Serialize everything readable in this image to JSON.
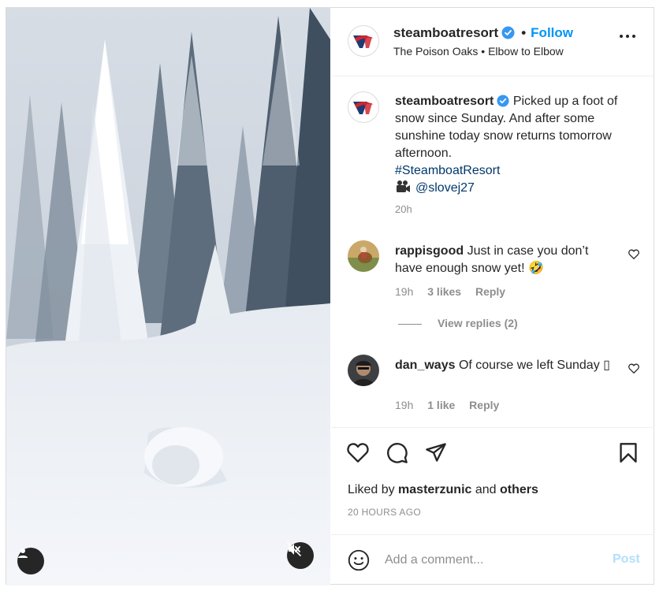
{
  "header": {
    "username": "steamboatresort",
    "verified": true,
    "separator": "•",
    "follow_label": "Follow",
    "location": "The Poison Oaks • Elbow to Elbow",
    "more_icon": "more-horizontal-icon"
  },
  "caption": {
    "username": "steamboatresort",
    "text": "Picked up a foot of snow since Sunday. And after some sunshine today snow returns tomorrow afternoon.",
    "hashtag": "#SteamboatResort",
    "camera_icon": "video-camera-icon",
    "mention": "@slovej27",
    "time": "20h"
  },
  "comments": [
    {
      "username": "rappisgood",
      "text": "Just in case you don’t have enough snow yet! 🤣",
      "time": "19h",
      "likes": "3 likes",
      "reply_label": "Reply"
    },
    {
      "username": "dan_ways",
      "text": "Of course we left Sunday ▯",
      "time": "19h",
      "likes": "1 like",
      "reply_label": "Reply"
    }
  ],
  "view_replies_label": "View replies (2)",
  "liked_by": {
    "prefix": "Liked by",
    "user": "masterzunic",
    "and": "and",
    "others": "others"
  },
  "timestamp": "20 HOURS AGO",
  "add_comment": {
    "placeholder": "Add a comment...",
    "post_label": "Post"
  },
  "colors": {
    "accent": "#0095f6",
    "verified": "#3897f0",
    "post_disabled": "#b2dffc",
    "link": "#00376b",
    "muted_text": "#8e8e8e"
  }
}
